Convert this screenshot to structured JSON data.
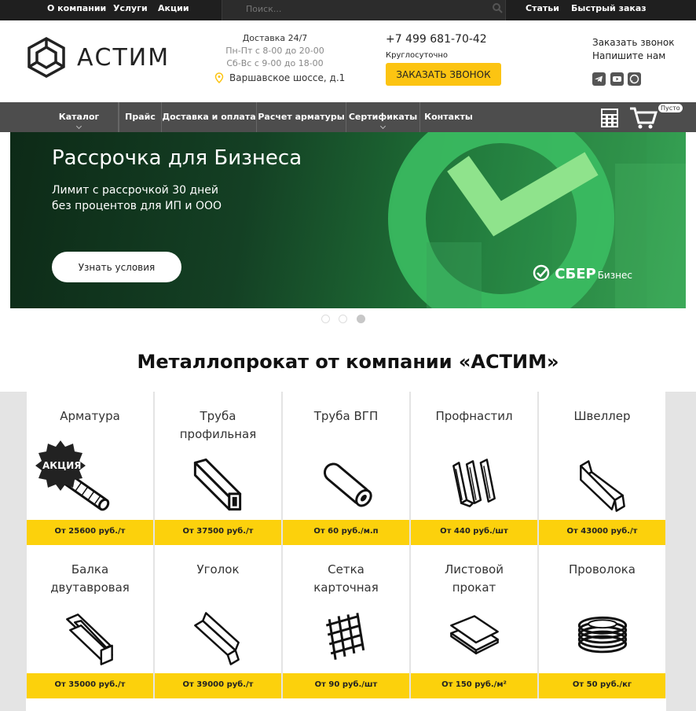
{
  "topbar": {
    "links": [
      "О компании",
      "Услуги",
      "Акции"
    ],
    "search_placeholder": "Поиск...",
    "right_links": [
      "Статьи",
      "Быстрый заказ"
    ]
  },
  "header": {
    "brand": "АСТИМ",
    "delivery": "Доставка 24/7",
    "hours1": "Пн-Пт с 8-00 до 20-00",
    "hours2": "Сб-Вс с 9-00 до 18-00",
    "address": "Варшавское шоссе, д.1",
    "phone": "+7 499 681-70-42",
    "all_day": "Круглосуточно",
    "call_button": "ЗАКАЗАТЬ ЗВОНОК",
    "order_call": "Заказать звонок",
    "write_us": "Напишите нам"
  },
  "nav": {
    "items": [
      "Каталог",
      "Прайс",
      "Доставка и оплата",
      "Расчет арматуры",
      "Сертификаты",
      "Контакты"
    ],
    "cart_badge": "Пусто"
  },
  "banner": {
    "title": "Рассрочка для Бизнеса",
    "line1": "Лимит с рассрочкой 30 дней",
    "line2": "без процентов для ИП и ООО",
    "button": "Узнать условия",
    "brand": "СБЕР",
    "brand_sub": "Бизнес"
  },
  "section_title": "Металлопрокат от компании «АСТИМ»",
  "promo_badge": "АКЦИЯ",
  "products": [
    {
      "name1": "Арматура",
      "name2": "",
      "price": "От 25600 руб./т",
      "icon": "rebar-icon"
    },
    {
      "name1": "Труба",
      "name2": "профильная",
      "price": "От 37500 руб./т",
      "icon": "profile-pipe-icon"
    },
    {
      "name1": "Труба ВГП",
      "name2": "",
      "price": "От 60 руб./м.п",
      "icon": "round-pipe-icon"
    },
    {
      "name1": "Профнастил",
      "name2": "",
      "price": "От 440 руб./шт",
      "icon": "corrugated-sheet-icon"
    },
    {
      "name1": "Швеллер",
      "name2": "",
      "price": "От 43000 руб./т",
      "icon": "channel-icon"
    },
    {
      "name1": "Балка",
      "name2": "двутавровая",
      "price": "От 35000 руб./т",
      "icon": "i-beam-icon"
    },
    {
      "name1": "Уголок",
      "name2": "",
      "price": "От 39000 руб./т",
      "icon": "angle-icon"
    },
    {
      "name1": "Сетка",
      "name2": "карточная",
      "price": "От 90 руб./шт",
      "icon": "mesh-icon"
    },
    {
      "name1": "Листовой",
      "name2": "прокат",
      "price": "От 150 руб./м²",
      "icon": "sheet-metal-icon"
    },
    {
      "name1": "Проволока",
      "name2": "",
      "price": "От 50 руб./кг",
      "icon": "wire-coil-icon"
    }
  ],
  "colors": {
    "accent": "#fcc412",
    "topbar": "#1f1f1f",
    "nav": "#4d4d4d"
  }
}
